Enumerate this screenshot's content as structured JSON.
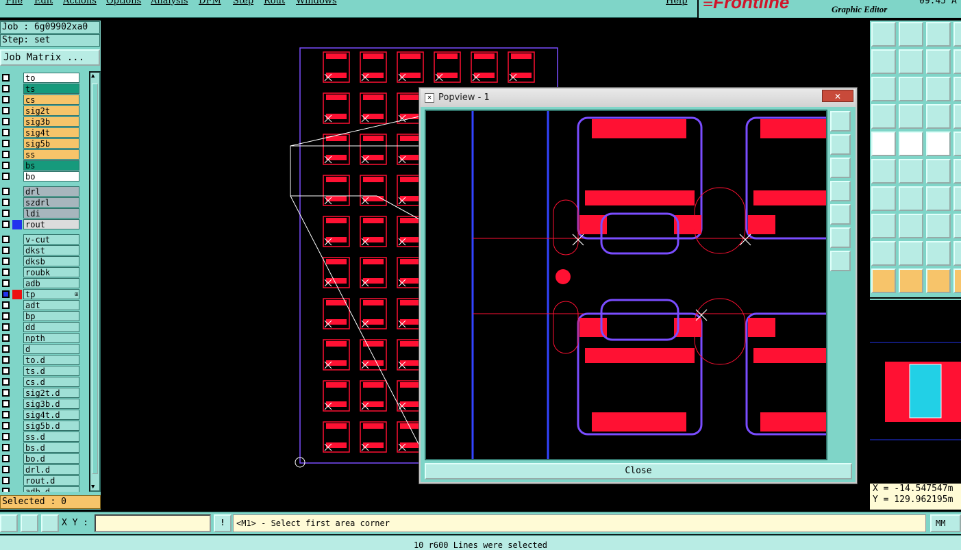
{
  "menubar": {
    "items": [
      "File",
      "Edit",
      "Actions",
      "Options",
      "Analysis",
      "DFM",
      "Step",
      "Rout",
      "Windows"
    ],
    "help": "Help"
  },
  "brand": {
    "logo": "Frontline",
    "subtitle": "Graphic Editor",
    "clock": "09:45 A"
  },
  "job": {
    "job_line": "Job : 6g09902xa0",
    "step_line": "Step: set",
    "matrix_button": "Job Matrix ..."
  },
  "layers": [
    {
      "name": "to",
      "color": "#ffffff",
      "swatch": ""
    },
    {
      "name": "ts",
      "color": "#169a7c",
      "swatch": ""
    },
    {
      "name": "cs",
      "color": "#f7c46a",
      "swatch": ""
    },
    {
      "name": "sig2t",
      "color": "#f7c46a",
      "swatch": ""
    },
    {
      "name": "sig3b",
      "color": "#f7c46a",
      "swatch": ""
    },
    {
      "name": "sig4t",
      "color": "#f7c46a",
      "swatch": ""
    },
    {
      "name": "sig5b",
      "color": "#f7c46a",
      "swatch": ""
    },
    {
      "name": "ss",
      "color": "#f7c46a",
      "swatch": ""
    },
    {
      "name": "bs",
      "color": "#169a7c",
      "swatch": ""
    },
    {
      "name": "bo",
      "color": "#ffffff",
      "swatch": ""
    },
    {
      "name": "drl",
      "color": "#a7b6bd",
      "swatch": ""
    },
    {
      "name": "szdrl",
      "color": "#a7b6bd",
      "swatch": ""
    },
    {
      "name": "ldi",
      "color": "#a7b6bd",
      "swatch": ""
    },
    {
      "name": "rout",
      "color": "#dcdcdc",
      "swatch": "#2233ee"
    },
    {
      "name": "v-cut",
      "color": "#9fe0d6",
      "swatch": ""
    },
    {
      "name": "dkst",
      "color": "#9fe0d6",
      "swatch": ""
    },
    {
      "name": "dksb",
      "color": "#9fe0d6",
      "swatch": ""
    },
    {
      "name": "roubk",
      "color": "#9fe0d6",
      "swatch": ""
    },
    {
      "name": "adb",
      "color": "#9fe0d6",
      "swatch": ""
    },
    {
      "name": "tp",
      "color": "#9fe0d6",
      "swatch": "#ee1111",
      "active": true
    },
    {
      "name": "adt",
      "color": "#9fe0d6",
      "swatch": ""
    },
    {
      "name": "bp",
      "color": "#9fe0d6",
      "swatch": ""
    },
    {
      "name": "dd",
      "color": "#9fe0d6",
      "swatch": ""
    },
    {
      "name": "npth",
      "color": "#9fe0d6",
      "swatch": ""
    },
    {
      "name": "d",
      "color": "#9fe0d6",
      "swatch": ""
    },
    {
      "name": "to.d",
      "color": "#9fe0d6",
      "swatch": ""
    },
    {
      "name": "ts.d",
      "color": "#9fe0d6",
      "swatch": ""
    },
    {
      "name": "cs.d",
      "color": "#9fe0d6",
      "swatch": ""
    },
    {
      "name": "sig2t.d",
      "color": "#9fe0d6",
      "swatch": ""
    },
    {
      "name": "sig3b.d",
      "color": "#9fe0d6",
      "swatch": ""
    },
    {
      "name": "sig4t.d",
      "color": "#9fe0d6",
      "swatch": ""
    },
    {
      "name": "sig5b.d",
      "color": "#9fe0d6",
      "swatch": ""
    },
    {
      "name": "ss.d",
      "color": "#9fe0d6",
      "swatch": ""
    },
    {
      "name": "bs.d",
      "color": "#9fe0d6",
      "swatch": ""
    },
    {
      "name": "bo.d",
      "color": "#9fe0d6",
      "swatch": ""
    },
    {
      "name": "drl.d",
      "color": "#9fe0d6",
      "swatch": ""
    },
    {
      "name": "rout.d",
      "color": "#9fe0d6",
      "swatch": ""
    },
    {
      "name": "adb.d",
      "color": "#9fe0d6",
      "swatch": ""
    }
  ],
  "selected": "Selected : 0",
  "popview": {
    "title": "Popview - 1",
    "close_x": "✕",
    "close_button": "Close"
  },
  "coords": {
    "x": "X = -14.547547m",
    "y": "Y = 129.962195m"
  },
  "bottom": {
    "xy_label": "X Y :",
    "xy_value": "",
    "prompt": "<M1> - Select first area corner",
    "unit": "MM"
  },
  "status": "10 r600 Lines were selected",
  "colors": {
    "panel": "#7fd5c8",
    "board_outline": "#7a4dff",
    "pad": "#ff1133",
    "selection": "#ffffff"
  }
}
